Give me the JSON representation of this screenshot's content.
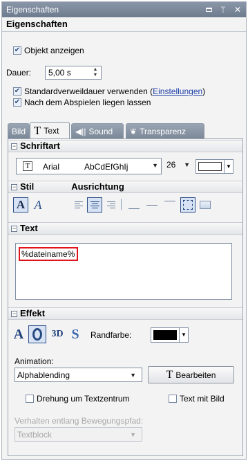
{
  "window": {
    "title": "Eigenschaften",
    "heading": "Eigenschaften"
  },
  "general": {
    "show_object_label": "Objekt anzeigen",
    "show_object_checked": true,
    "duration_label": "Dauer:",
    "duration_value": "5,00 s",
    "default_duration_label": "Standardverweildauer verwenden (",
    "default_duration_link": "Einstellungen",
    "default_duration_suffix": ")",
    "default_duration_checked": true,
    "keep_after_play_label": "Nach dem Abspielen liegen lassen",
    "keep_after_play_checked": true
  },
  "tabs": [
    {
      "label": "Bild",
      "active": false
    },
    {
      "label": "Text",
      "icon_text": "T",
      "active": true
    },
    {
      "label": "Sound",
      "active": false
    },
    {
      "label": "Transparenz",
      "active": false
    }
  ],
  "font": {
    "section_title": "Schriftart",
    "family": "Arial",
    "preview": "AbCdEfGhIj",
    "size": "26",
    "color": "#ffffff"
  },
  "style": {
    "section_title": "Stil",
    "align_title": "Ausrichtung",
    "bold_glyph": "A",
    "italic_glyph": "A"
  },
  "text": {
    "section_title": "Text",
    "value": "%dateiname%"
  },
  "effect": {
    "section_title": "Effekt",
    "effect_a": "A",
    "effect_3d": "3D",
    "effect_s": "S",
    "border_color_label": "Randfarbe:",
    "border_color": "#000000",
    "animation_label": "Animation:",
    "animation_value": "Alphablending",
    "edit_button": "Bearbeiten",
    "edit_icon_text": "T",
    "rotate_label": "Drehung um Textzentrum",
    "rotate_checked": false,
    "text_with_image_label": "Text mit Bild",
    "text_with_image_checked": false,
    "path_behavior_label": "Verhalten entlang Bewegungspfad:",
    "path_behavior_value": "Textblock"
  },
  "colors": {
    "titlebar": "#7a8799",
    "highlight_border": "#e0141c",
    "link": "#1f3fa8"
  }
}
